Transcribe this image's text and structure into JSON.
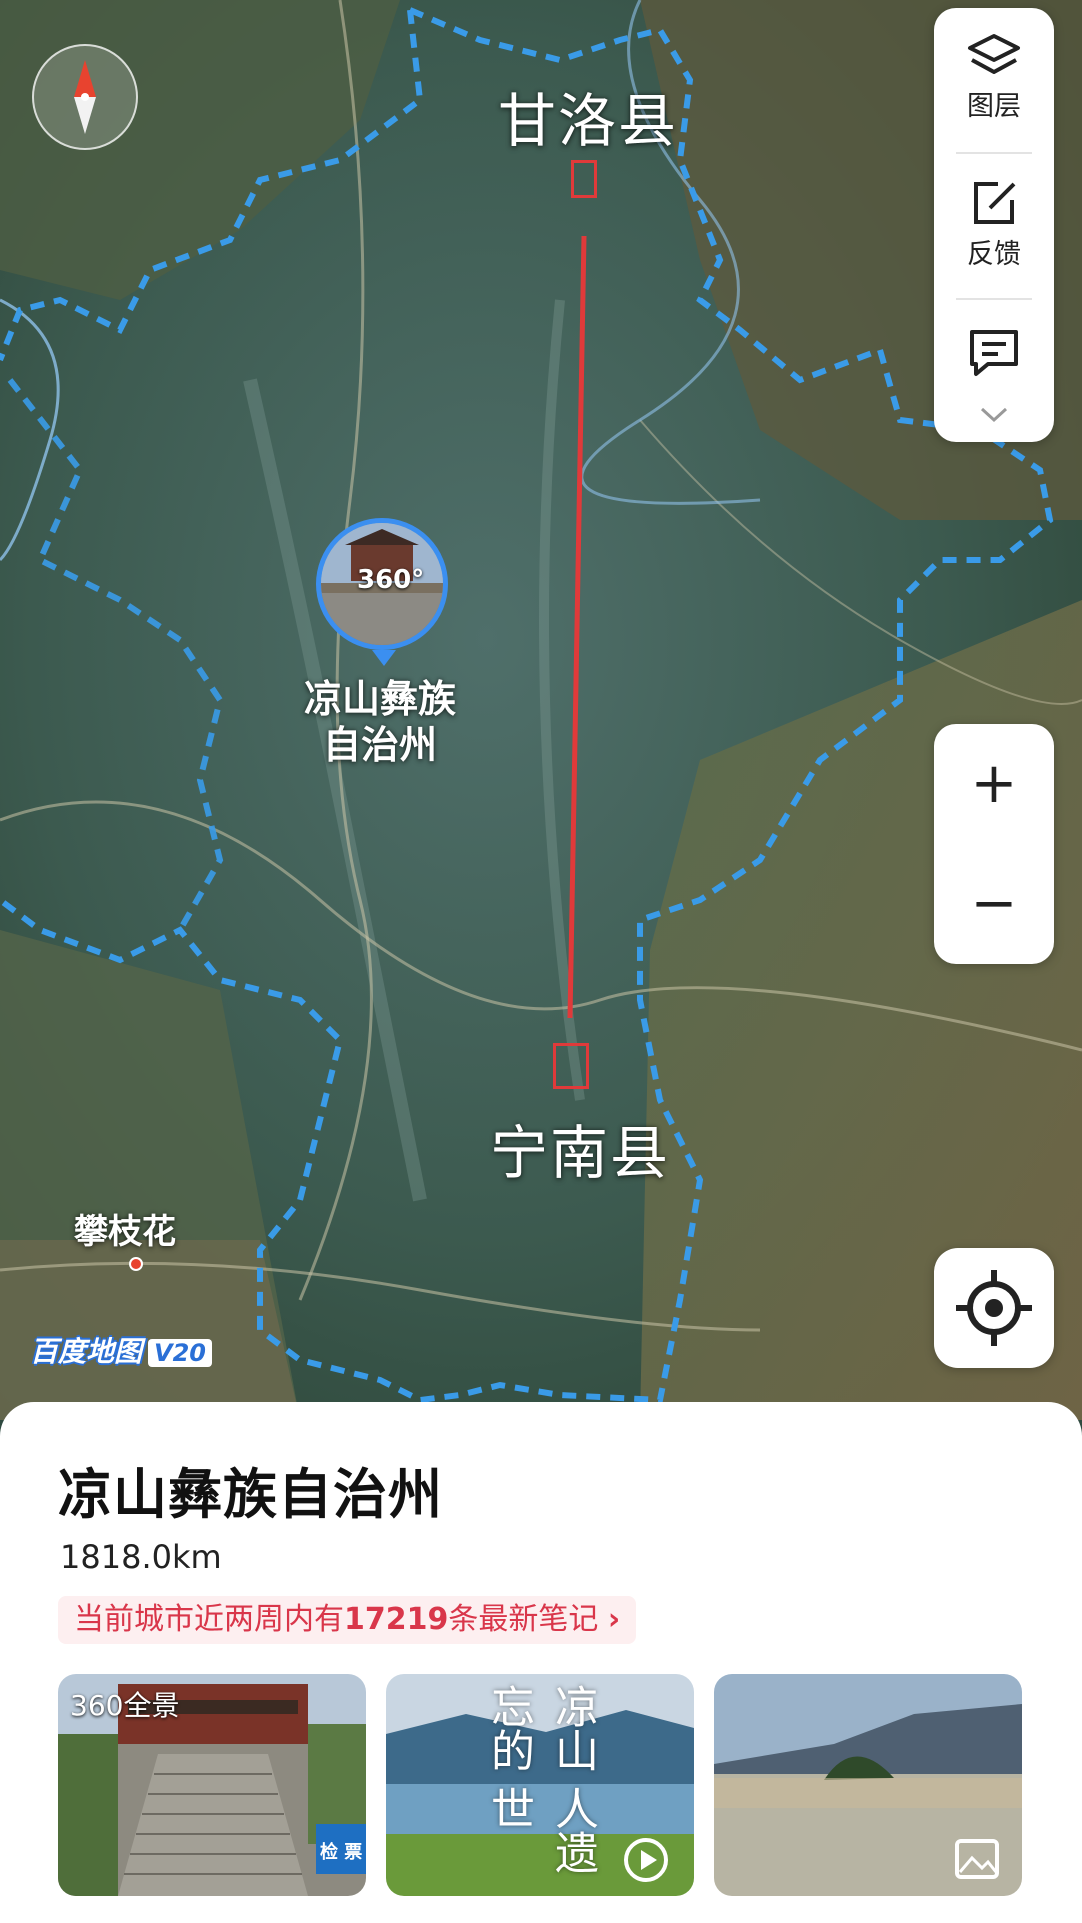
{
  "map": {
    "labels": {
      "ganluo": "甘洛县",
      "ningnan": "宁南县",
      "panzhihua": "攀枝花",
      "liangshan": "凉山彝族自治州"
    },
    "pano_badge": "360°",
    "watermark": "百度地图",
    "watermark_version": "V20",
    "compass_icon": "compass-icon"
  },
  "toolbar": {
    "layers_label": "图层",
    "feedback_label": "反馈",
    "message_icon": "message-icon",
    "expand_icon": "chevron-down-icon"
  },
  "zoom": {
    "in_label": "+",
    "out_label": "−"
  },
  "locate_icon": "locate-icon",
  "sheet": {
    "title": "凉山彝族自治州",
    "distance": "1818.0km",
    "notes_prefix": "当前城市近两周内有",
    "notes_count": "17219",
    "notes_suffix": "条最新笔记",
    "notes_arrow": "›",
    "thumbs": [
      {
        "tag": "360全景",
        "sign": "检 票"
      },
      {
        "text": "凉山 人遗忘的 世"
      },
      {
        "icon": "gallery-icon"
      }
    ]
  },
  "colors": {
    "boundary": "#3a9be8",
    "route": "#e03a3a",
    "accent": "#d9364a"
  }
}
